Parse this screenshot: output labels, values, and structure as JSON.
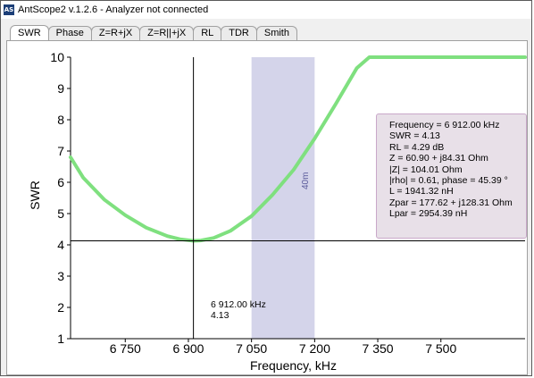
{
  "window": {
    "app_icon_text": "AS",
    "title": "AntScope2 v.1.2.6 - Analyzer not connected"
  },
  "tabs": [
    {
      "label": "SWR",
      "active": true
    },
    {
      "label": "Phase",
      "active": false
    },
    {
      "label": "Z=R+jX",
      "active": false
    },
    {
      "label": "Z=R||+jX",
      "active": false
    },
    {
      "label": "RL",
      "active": false
    },
    {
      "label": "TDR",
      "active": false
    },
    {
      "label": "Smith",
      "active": false
    }
  ],
  "chart_data": {
    "type": "line",
    "xlabel": "Frequency, kHz",
    "ylabel": "SWR",
    "xlim": [
      6620,
      7700
    ],
    "ylim": [
      1,
      10
    ],
    "x_ticks": [
      6750,
      6900,
      7050,
      7200,
      7350,
      7500
    ],
    "x_tick_labels": [
      "6 750",
      "6 900",
      "7 050",
      "7 200",
      "7 350",
      "7 500"
    ],
    "y_ticks": [
      1,
      2,
      3,
      4,
      5,
      6,
      7,
      8,
      9,
      10
    ],
    "y_tick_labels": [
      "1",
      "2",
      "3",
      "4",
      "5",
      "6",
      "7",
      "8",
      "9",
      "10"
    ],
    "series": [
      {
        "color": "#7fe07f",
        "x": [
          6620,
          6650,
          6700,
          6750,
          6800,
          6850,
          6880,
          6900,
          6912,
          6930,
          6960,
          7000,
          7050,
          7100,
          7150,
          7200,
          7250,
          7300,
          7330,
          7400,
          7500,
          7600,
          7700
        ],
        "y": [
          6.8,
          6.15,
          5.45,
          4.95,
          4.55,
          4.28,
          4.18,
          4.15,
          4.13,
          4.14,
          4.22,
          4.45,
          4.92,
          5.6,
          6.4,
          7.4,
          8.5,
          9.65,
          10,
          10,
          10,
          10,
          10
        ]
      }
    ],
    "band": {
      "from": 7050,
      "to": 7200,
      "label": "40m",
      "color": "#d4d4ea"
    },
    "cursor": {
      "x": 6912,
      "y": 4.13,
      "label_freq": "6 912.00 kHz",
      "label_swr": "4.13"
    }
  },
  "info": [
    "Frequency = 6 912.00 kHz",
    "SWR = 4.13",
    "RL = 4.29 dB",
    "Z = 60.90 + j84.31 Ohm",
    "|Z| = 104.01 Ohm",
    "|rho| = 0.61, phase = 45.39 °",
    "L = 1941.32 nH",
    "Zpar = 177.62 + j128.31 Ohm",
    "Lpar = 2954.39 nH"
  ]
}
